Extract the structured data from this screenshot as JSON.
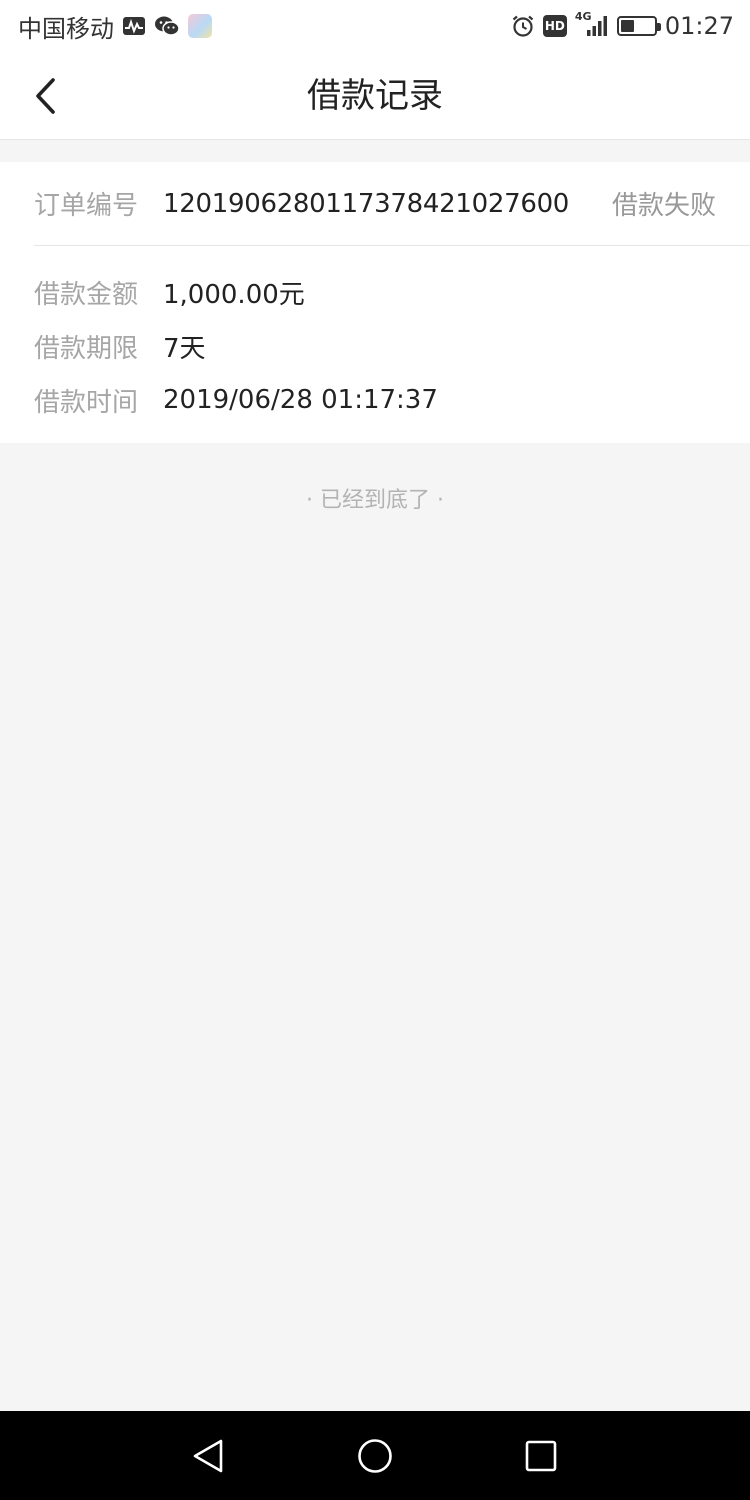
{
  "status_bar": {
    "carrier": "中国移动",
    "network": "4G",
    "hd": "HD",
    "battery_level": 0.4,
    "time": "01:27",
    "icons": [
      "activity-icon",
      "wechat-icon",
      "app-icon",
      "alarm-icon",
      "hd-icon",
      "signal-icon",
      "battery-icon"
    ]
  },
  "header": {
    "title": "借款记录",
    "back_icon": "chevron-left-icon"
  },
  "record": {
    "order_label": "订单编号",
    "order_no": "1201906280117378421027600",
    "status": "借款失败",
    "details": [
      {
        "label": "借款金额",
        "value": "1,000.00元"
      },
      {
        "label": "借款期限",
        "value": "7天"
      },
      {
        "label": "借款时间",
        "value": "2019/06/28 01:17:37"
      }
    ]
  },
  "footer": {
    "end_text": "· 已经到底了 ·"
  },
  "system_nav": {
    "icons": [
      "triangle-back-icon",
      "circle-home-icon",
      "square-recent-icon"
    ]
  },
  "colors": {
    "background": "#f5f5f5",
    "card": "#ffffff",
    "label": "#a6a6a6",
    "value": "#222222",
    "status": "#999999"
  }
}
